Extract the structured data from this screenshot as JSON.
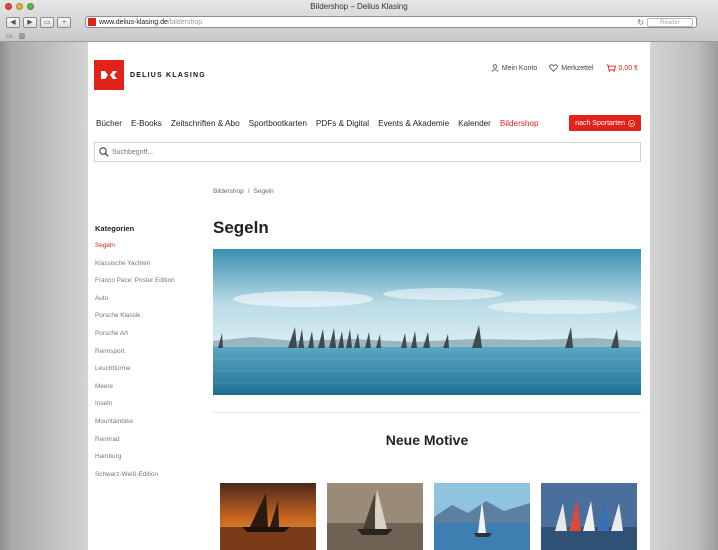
{
  "browser": {
    "window_title": "Bildershop – Delius Klasing",
    "url_domain": "www.delius-klasing.de",
    "url_path": "/bildershop",
    "reader_label": "Reader"
  },
  "header": {
    "logo_text": "DELIUS KLASING",
    "account_label": "Mein Konto",
    "wishlist_label": "Merkzettel",
    "cart_value": "0,00 €"
  },
  "nav": {
    "items": [
      {
        "label": "Bücher"
      },
      {
        "label": "E-Books"
      },
      {
        "label": "Zeitschriften & Abo"
      },
      {
        "label": "Sportbootkarten"
      },
      {
        "label": "PDFs & Digital"
      },
      {
        "label": "Events & Akademie"
      },
      {
        "label": "Kalender"
      },
      {
        "label": "Bildershop"
      }
    ],
    "sport_button": "nach Sportarten"
  },
  "search": {
    "placeholder": "Suchbegriff..."
  },
  "breadcrumb": {
    "root": "Bildershop",
    "separator": "/",
    "current": "Segeln"
  },
  "page_title": "Segeln",
  "sidebar": {
    "heading": "Kategorien",
    "items": [
      {
        "label": "Segeln"
      },
      {
        "label": "Klassische Yachten"
      },
      {
        "label": "Franco Pace: Poster Edition"
      },
      {
        "label": "Auto"
      },
      {
        "label": "Porsche Klassik"
      },
      {
        "label": "Porsche Art"
      },
      {
        "label": "Rennsport"
      },
      {
        "label": "Leuchttürme"
      },
      {
        "label": "Meere"
      },
      {
        "label": "Inseln"
      },
      {
        "label": "Mountainbike"
      },
      {
        "label": "Rennrad"
      },
      {
        "label": "Hamburg"
      },
      {
        "label": "Schwarz-Weiß-Edition"
      }
    ]
  },
  "section_title": "Neue Motive",
  "colors": {
    "accent": "#e2231a"
  }
}
